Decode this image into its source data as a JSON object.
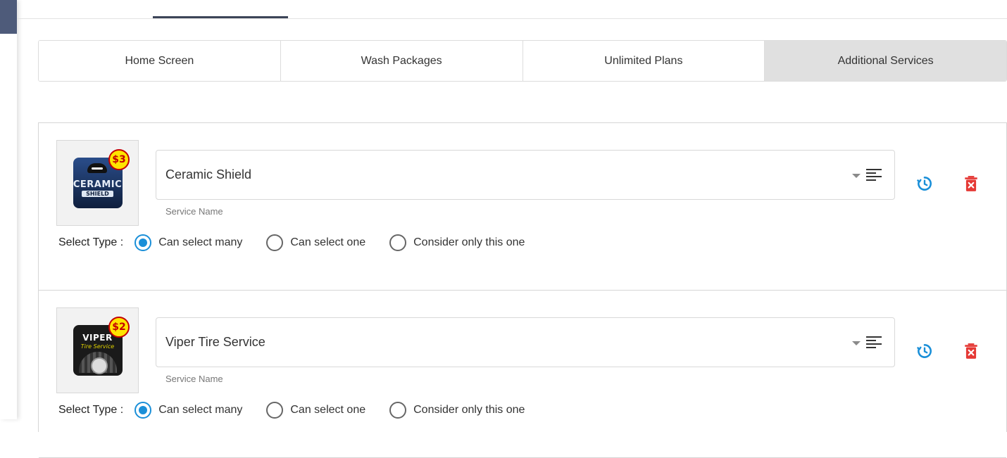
{
  "tabs": [
    {
      "label": "Home Screen",
      "active": false
    },
    {
      "label": "Wash Packages",
      "active": false
    },
    {
      "label": "Unlimited Plans",
      "active": false
    },
    {
      "label": "Additional Services",
      "active": true
    }
  ],
  "services": [
    {
      "name": "Ceramic Shield",
      "field_label": "Service Name",
      "price_badge": "$3",
      "icon_top": "CERAMIC",
      "icon_bottom": "SHIELD",
      "select_type_label": "Select Type :",
      "options": [
        {
          "label": "Can select many",
          "checked": true
        },
        {
          "label": "Can select one",
          "checked": false
        },
        {
          "label": "Consider only this one",
          "checked": false
        }
      ]
    },
    {
      "name": "Viper Tire Service",
      "field_label": "Service Name",
      "price_badge": "$2",
      "icon_top": "VIPER",
      "icon_bottom": "Tire Service",
      "select_type_label": "Select Type :",
      "options": [
        {
          "label": "Can select many",
          "checked": true
        },
        {
          "label": "Can select one",
          "checked": false
        },
        {
          "label": "Consider only this one",
          "checked": false
        }
      ]
    }
  ],
  "colors": {
    "accent": "#1a8fd8",
    "delete": "#e53935",
    "active_tab": "#e0e0e0"
  },
  "icons": {
    "refresh": "history-icon",
    "delete": "trash-icon",
    "description": "align-left-icon"
  }
}
